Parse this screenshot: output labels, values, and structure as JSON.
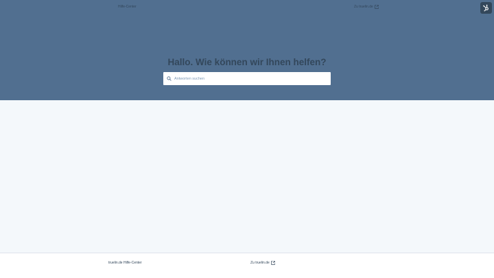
{
  "header": {
    "home_link": "Hilfe-Center",
    "external_link": "Zu truelin.de",
    "badge_icon": "hubspot-sprocket-icon"
  },
  "hero": {
    "title": "Hallo. Wie können wir Ihnen helfen?",
    "search": {
      "placeholder": "Antworten suchen",
      "value": "",
      "icon": "search-icon"
    }
  },
  "footer": {
    "site_link": "truelin.de Hilfe-Center",
    "external_link": "Zu truelin.de"
  },
  "colors": {
    "hero_bg": "#516f90",
    "page_bg": "#f4f8fb",
    "text": "#33475b",
    "badge_bg": "#33475b"
  }
}
